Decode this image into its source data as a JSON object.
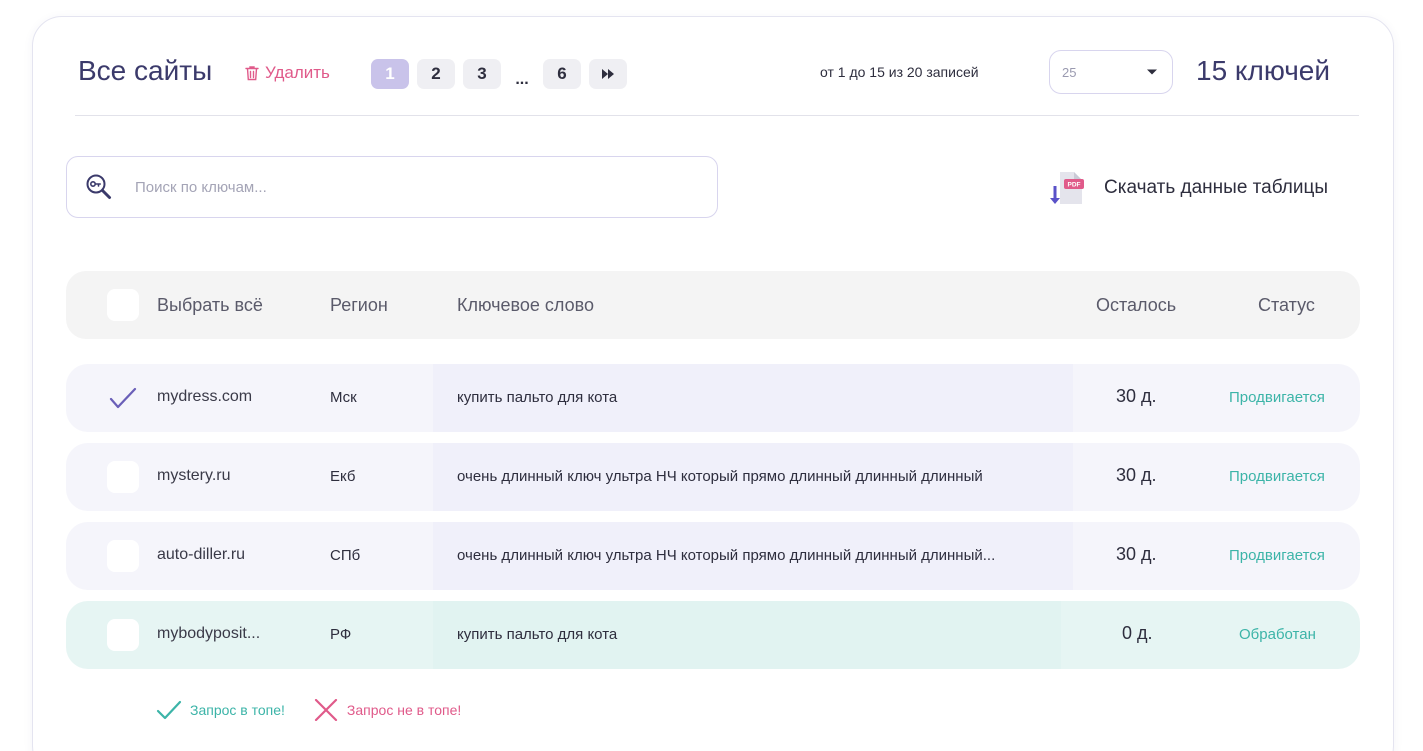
{
  "header": {
    "title": "Все сайты",
    "delete_label": "Удалить",
    "pages": [
      "1",
      "2",
      "3",
      "6"
    ],
    "ellipsis": "...",
    "active_page": "1",
    "records_info": "от 1 до 15 из 20 записей",
    "page_size": "25",
    "keys_count": "15 ключей"
  },
  "search": {
    "placeholder": "Поиск по ключам..."
  },
  "download": {
    "label": "Скачать данные таблицы",
    "badge": "PDF"
  },
  "table": {
    "columns": {
      "select_all": "Выбрать всё",
      "region": "Регион",
      "keyword": "Ключевое слово",
      "remaining": "Осталось",
      "status": "Статус"
    },
    "rows": [
      {
        "site": "mydress.com",
        "region": "Мск",
        "keyword": "купить пальто для кота",
        "remaining": "30 д.",
        "status": "Продвигается",
        "checked": true
      },
      {
        "site": "mystery.ru",
        "region": "Екб",
        "keyword": "очень длинный ключ ультра НЧ который прямо длинный длинный длинный",
        "remaining": "30 д.",
        "status": "Продвигается",
        "checked": false
      },
      {
        "site": "auto-diller.ru",
        "region": "СПб",
        "keyword": "очень длинный ключ ультра НЧ который прямо длинный длинный длинный...",
        "remaining": "30 д.",
        "status": "Продвигается",
        "checked": false
      },
      {
        "site": "mybodyposit...",
        "region": "РФ",
        "keyword": "купить пальто для кота",
        "remaining": "0 д.",
        "status": "Обработан",
        "checked": false
      }
    ]
  },
  "legend": {
    "in_top": "Запрос в топе!",
    "not_in_top": "Запрос не в топе!"
  },
  "colors": {
    "accent": "#3b3a6b",
    "active_page": "#c9c3ea",
    "delete": "#e05a8a",
    "status_ok": "#3cb4a8"
  },
  "icons": {
    "delete": "trash-icon",
    "next": "fast-forward-icon",
    "select": "chevron-down-icon",
    "search": "key-search-icon",
    "download": "pdf-download-icon",
    "check": "checkmark-icon",
    "cross": "cross-icon"
  }
}
